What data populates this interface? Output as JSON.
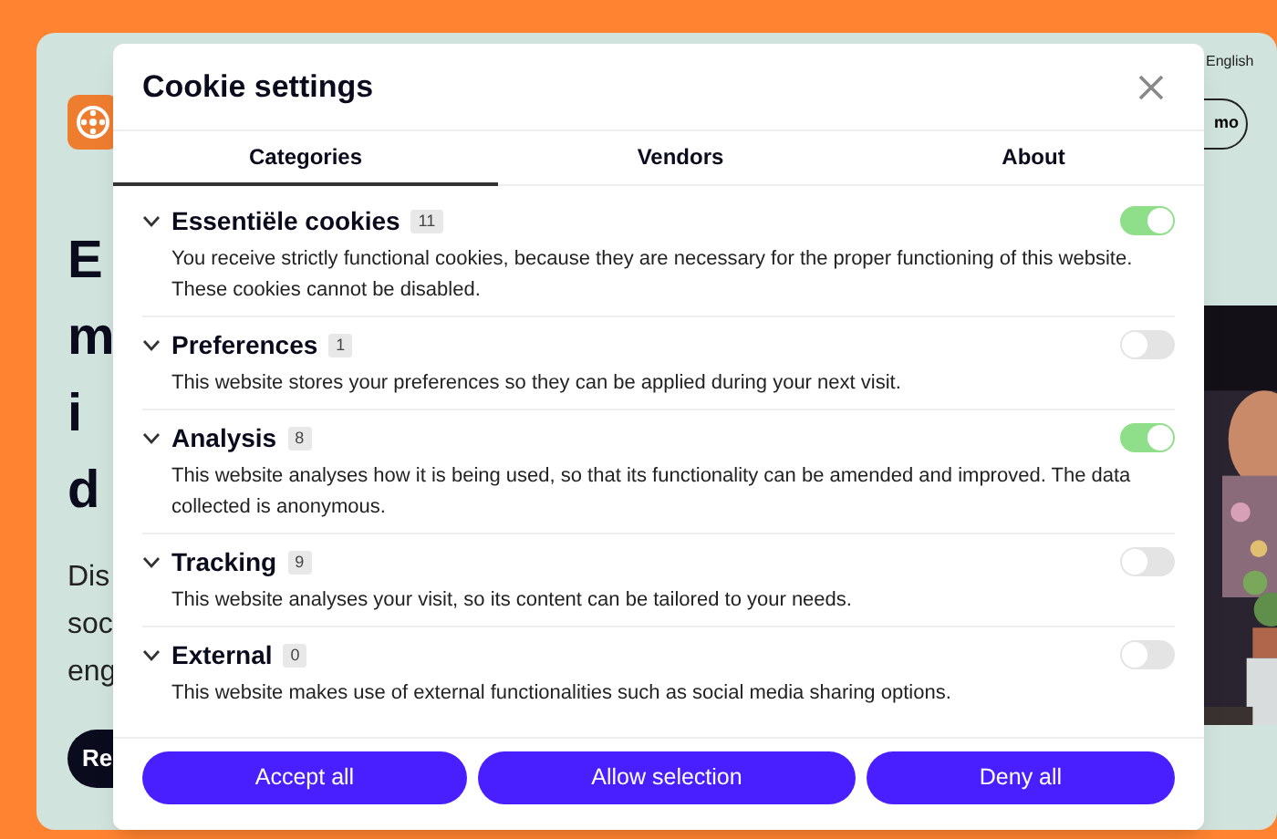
{
  "background_page": {
    "language": "English",
    "demo_button": "mo",
    "heading_lines": [
      "E",
      "m",
      "i",
      "d"
    ],
    "intro_lines": [
      "Dis",
      "soc",
      "eng"
    ],
    "cta_button": "Re"
  },
  "dialog": {
    "title": "Cookie settings",
    "tabs": [
      {
        "label": "Categories",
        "selected": true
      },
      {
        "label": "Vendors",
        "selected": false
      },
      {
        "label": "About",
        "selected": false
      }
    ],
    "categories": [
      {
        "name": "Essentiële cookies",
        "count": "11",
        "on": true,
        "expanded": false,
        "description": "You receive strictly functional cookies, because they are necessary for the proper functioning of this website. These cookies cannot be disabled."
      },
      {
        "name": "Preferences",
        "count": "1",
        "on": false,
        "expanded": false,
        "description": "This website stores your preferences so they can be applied during your next visit."
      },
      {
        "name": "Analysis",
        "count": "8",
        "on": true,
        "expanded": false,
        "description": "This website analyses how it is being used, so that its functionality can be amended and improved. The data collected is anonymous."
      },
      {
        "name": "Tracking",
        "count": "9",
        "on": false,
        "expanded": false,
        "description": "This website analyses your visit, so its content can be tailored to your needs."
      },
      {
        "name": "External",
        "count": "0",
        "on": false,
        "expanded": false,
        "description": "This website makes use of external functionalities such as social media sharing options."
      }
    ],
    "buttons": [
      "Accept all",
      "Allow selection",
      "Deny all"
    ]
  }
}
